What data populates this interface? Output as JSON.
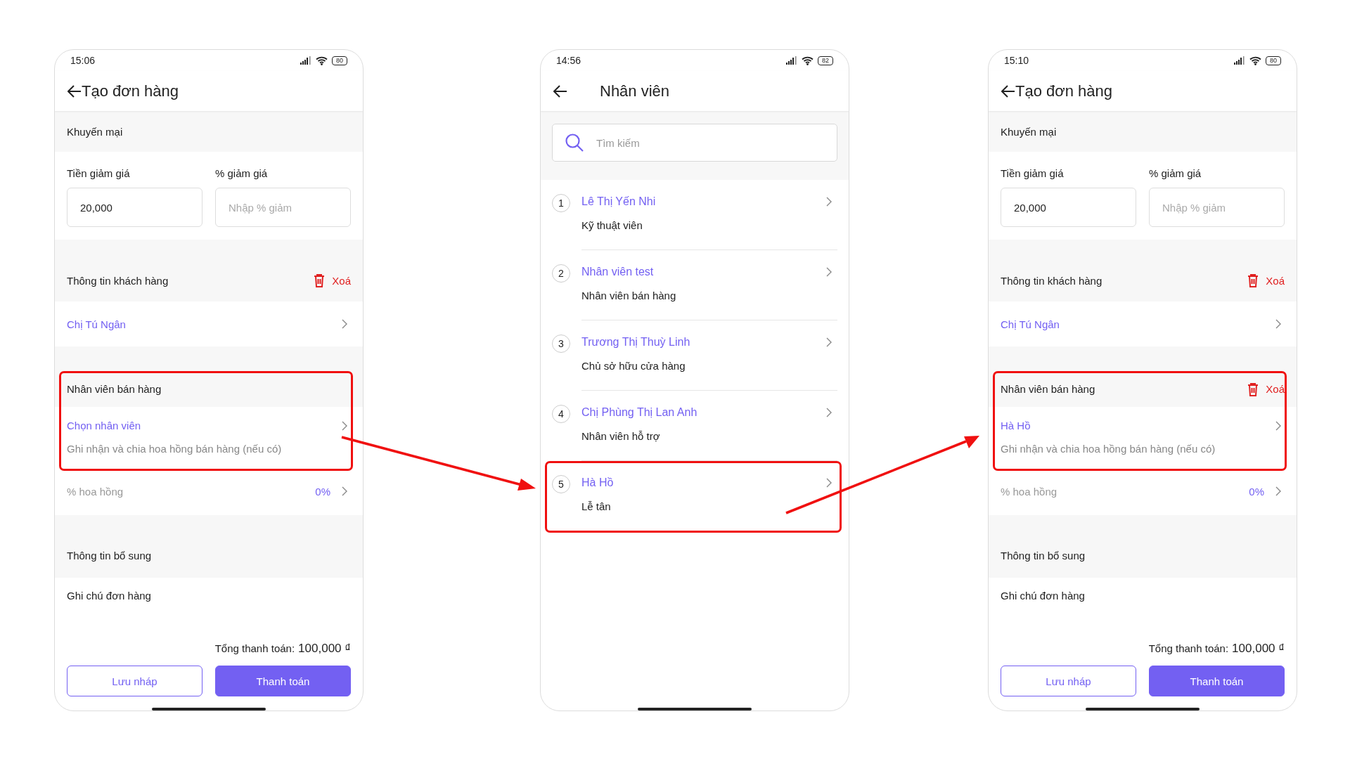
{
  "screens": [
    {
      "kind": "order",
      "status_time": "15:06",
      "battery": "80",
      "title": "Tạo đơn hàng",
      "promo": {
        "title": "Khuyến mại",
        "fields": [
          {
            "label": "Tiền giảm giá",
            "value": "20,000"
          },
          {
            "label": "% giảm giá",
            "placeholder": "Nhập % giảm"
          }
        ]
      },
      "customer": {
        "title": "Thông tin khách hàng",
        "delete_label": "Xoá",
        "name": "Chị Tú Ngân"
      },
      "staff": {
        "title": "Nhân viên bán hàng",
        "value": "Chọn nhân viên",
        "hint": "Ghi nhận và chia hoa hồng bán hàng (nếu có)",
        "highlighted": true
      },
      "commission": {
        "label": "% hoa hồng",
        "value": "0%"
      },
      "extra": {
        "title": "Thông tin bổ sung",
        "note_label": "Ghi chú đơn hàng"
      },
      "total": {
        "label": "Tổng thanh toán:",
        "value": "100,000 ₫"
      },
      "buttons": [
        {
          "label": "Lưu nháp",
          "kind": "outline"
        },
        {
          "label": "Thanh toán",
          "kind": "primary"
        }
      ]
    },
    {
      "kind": "staff_list",
      "status_time": "14:56",
      "battery": "82",
      "title": "Nhân viên",
      "search": {
        "placeholder": "Tìm kiếm"
      },
      "items": [
        {
          "number": "1",
          "name": "Lê Thị Yến Nhi",
          "role": "Kỹ thuật viên",
          "highlighted": false
        },
        {
          "number": "2",
          "name": "Nhân viên test",
          "role": "Nhân viên bán hàng",
          "highlighted": false
        },
        {
          "number": "3",
          "name": "Trương Thị Thuỳ Linh",
          "role": "Chủ sở hữu cửa hàng",
          "highlighted": false
        },
        {
          "number": "4",
          "name": "Chị Phùng Thị Lan Anh",
          "role": "Nhân viên hỗ trợ",
          "highlighted": false
        },
        {
          "number": "5",
          "name": "Hà Hồ",
          "role": "Lễ tân",
          "highlighted": true
        }
      ]
    },
    {
      "kind": "order",
      "status_time": "15:10",
      "battery": "80",
      "title": "Tạo đơn hàng",
      "promo": {
        "title": "Khuyến mại",
        "fields": [
          {
            "label": "Tiền giảm giá",
            "value": "20,000"
          },
          {
            "label": "% giảm giá",
            "placeholder": "Nhập % giảm"
          }
        ]
      },
      "customer": {
        "title": "Thông tin khách hàng",
        "delete_label": "Xoá",
        "name": "Chị Tú Ngân"
      },
      "staff": {
        "title": "Nhân viên bán hàng",
        "delete_label": "Xoá",
        "value": "Hà Hồ",
        "hint": "Ghi nhận và chia hoa hồng bán hàng (nếu có)",
        "highlighted": true
      },
      "commission": {
        "label": "% hoa hồng",
        "value": "0%"
      },
      "extra": {
        "title": "Thông tin bổ sung",
        "note_label": "Ghi chú đơn hàng"
      },
      "total": {
        "label": "Tổng thanh toán:",
        "value": "100,000 ₫"
      },
      "buttons": [
        {
          "label": "Lưu nháp",
          "kind": "outline"
        },
        {
          "label": "Thanh toán",
          "kind": "primary"
        }
      ]
    }
  ]
}
